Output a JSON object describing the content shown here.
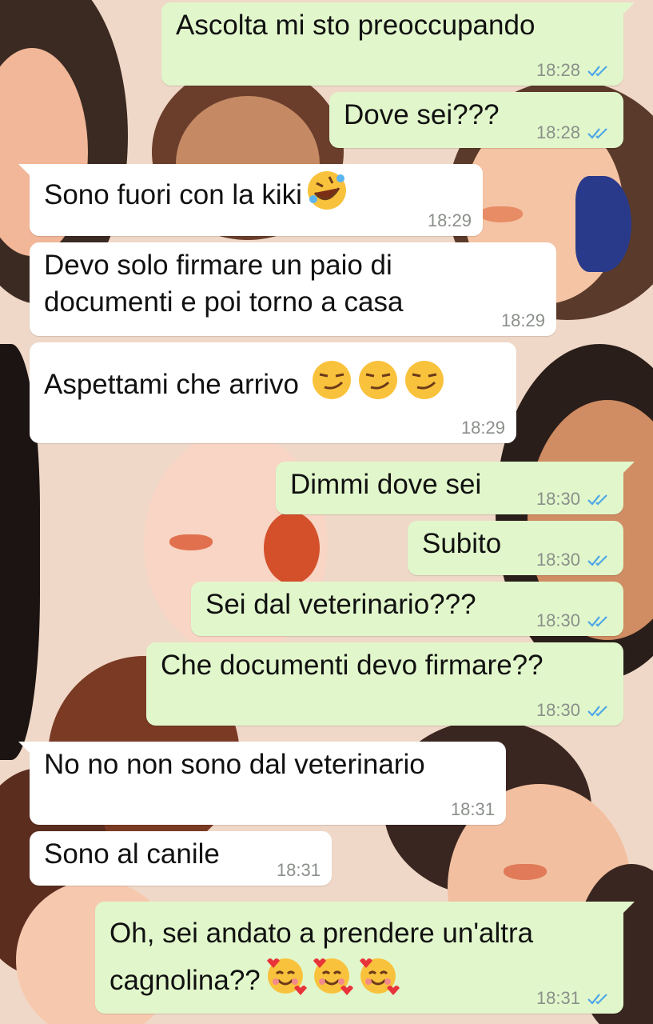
{
  "colors": {
    "outgoing_bubble": "#e1f7cb",
    "incoming_bubble": "#ffffff",
    "read_ticks": "#4fa6e6",
    "time_text": "#8a8f8a"
  },
  "messages": [
    {
      "dir": "out",
      "lines": [
        "Ascolta mi sto preoccupando"
      ],
      "time": "18:28",
      "status": "read-ticks-icon"
    },
    {
      "dir": "out",
      "lines": [
        "Dove sei???"
      ],
      "time": "18:28",
      "status": "read-ticks-icon"
    },
    {
      "dir": "in",
      "lines": [
        "Sono fuori con la kiki"
      ],
      "emoji": [
        "rolling-laughing-emoji"
      ],
      "time": "18:29"
    },
    {
      "dir": "in",
      "lines": [
        "Devo solo firmare un paio di",
        "documenti e poi torno a casa"
      ],
      "time": "18:29"
    },
    {
      "dir": "in",
      "lines": [
        "Aspettami che arrivo "
      ],
      "emoji": [
        "smirking-face-emoji",
        "smirking-face-emoji",
        "smirking-face-emoji"
      ],
      "time": "18:29"
    },
    {
      "dir": "out",
      "lines": [
        "Dimmi dove sei"
      ],
      "time": "18:30",
      "status": "read-ticks-icon"
    },
    {
      "dir": "out",
      "lines": [
        "Subito"
      ],
      "time": "18:30",
      "status": "read-ticks-icon"
    },
    {
      "dir": "out",
      "lines": [
        "Sei dal veterinario???"
      ],
      "time": "18:30",
      "status": "read-ticks-icon"
    },
    {
      "dir": "out",
      "lines": [
        "Che documenti devo firmare??"
      ],
      "time": "18:30",
      "status": "read-ticks-icon"
    },
    {
      "dir": "in",
      "lines": [
        "No no non sono dal veterinario"
      ],
      "time": "18:31"
    },
    {
      "dir": "in",
      "lines": [
        "Sono al canile"
      ],
      "time": "18:31"
    },
    {
      "dir": "out",
      "lines": [
        "Oh, sei andato a prendere un'altra",
        "cagnolina??"
      ],
      "emoji": [
        "smiling-face-with-hearts-emoji",
        "smiling-face-with-hearts-emoji",
        "smiling-face-with-hearts-emoji"
      ],
      "time": "18:31",
      "status": "read-ticks-icon"
    }
  ]
}
